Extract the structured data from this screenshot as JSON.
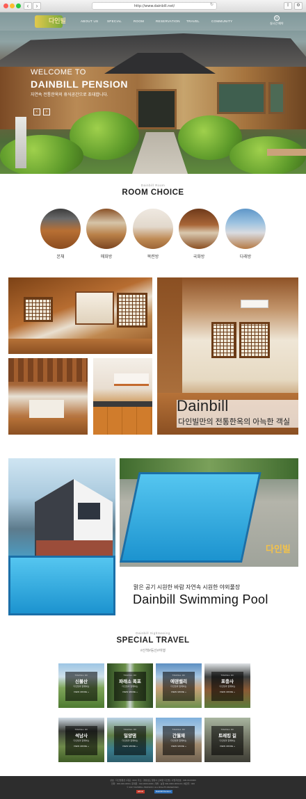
{
  "browser": {
    "url": "http://www.dainbill.net/",
    "back_glyph": "‹",
    "forward_glyph": "›",
    "reload_glyph": "↻",
    "share_glyph": "⇪",
    "settings_glyph": "⚙",
    "icons": [
      "back-icon",
      "forward-icon",
      "reload-icon",
      "share-icon",
      "settings-icon"
    ]
  },
  "nav": {
    "logo_text": "다인빌",
    "items": [
      "ABOUT US",
      "SPECIAL",
      "ROOM",
      "RESERVATION",
      "TRAVEL",
      "COMMUNITY"
    ],
    "util_label": "실시간 예약",
    "util_icon": "clock-icon"
  },
  "hero": {
    "welcome": "WELCOME TO",
    "brand": "DAINBILL PENSION",
    "subtitle": "자연속 전통한옥의 휴식공간으로 초대합니다.",
    "prev": "‹",
    "next": "›"
  },
  "rooms": {
    "eyebrow": "Dainbill Room",
    "title": "ROOM CHOICE",
    "items": [
      "본채",
      "매화방",
      "목련방",
      "국화방",
      "다래방"
    ]
  },
  "interior": {
    "title_en": "Dainbill",
    "title_ko": "다인빌만의 전통한옥의 아늑한 객실"
  },
  "pool": {
    "caption_ko": "맑은 공기 시원한 바람 자연속 시원한 야외풀장",
    "title_en": "Dainbill Swimming Pool",
    "watermark": "다인빌"
  },
  "travel": {
    "eyebrow": "Dainbill Sightseeing",
    "title": "SPECIAL TRAVEL",
    "subtitle": "#산책#등산#여행",
    "card_eyebrow": "TRAVEL OF",
    "card_desc": "다인빌과 함께하는",
    "view_more": "VIEW MORE +",
    "items": [
      "신불산",
      "파래소 폭포",
      "에덴밸리",
      "표충사",
      "석남사",
      "밀양댐",
      "간월재",
      "트레킹 길"
    ]
  },
  "colors": {
    "accent": "#2d2d2d",
    "pool_blue": "#1c93cf",
    "wood": "#8a4f22"
  },
  "footer": {
    "lines": [
      "상호 : 다인빌펜션 | 대표 : 000 | 주소 : 경상남도 밀양시 산외면 다인빌 | 사업자번호 : 000-00-00000",
      "전화 : 000-000-0000 | 휴대폰 : 010-0000-0000 | 계좌 : 농협 000-0000-0000-00 | 예금주 : 000",
      "© 2017 DAINBILL PENSION. ALL RIGHTS RESERVED."
    ],
    "badges": [
      "admin",
      "Dainbill Pension"
    ]
  }
}
